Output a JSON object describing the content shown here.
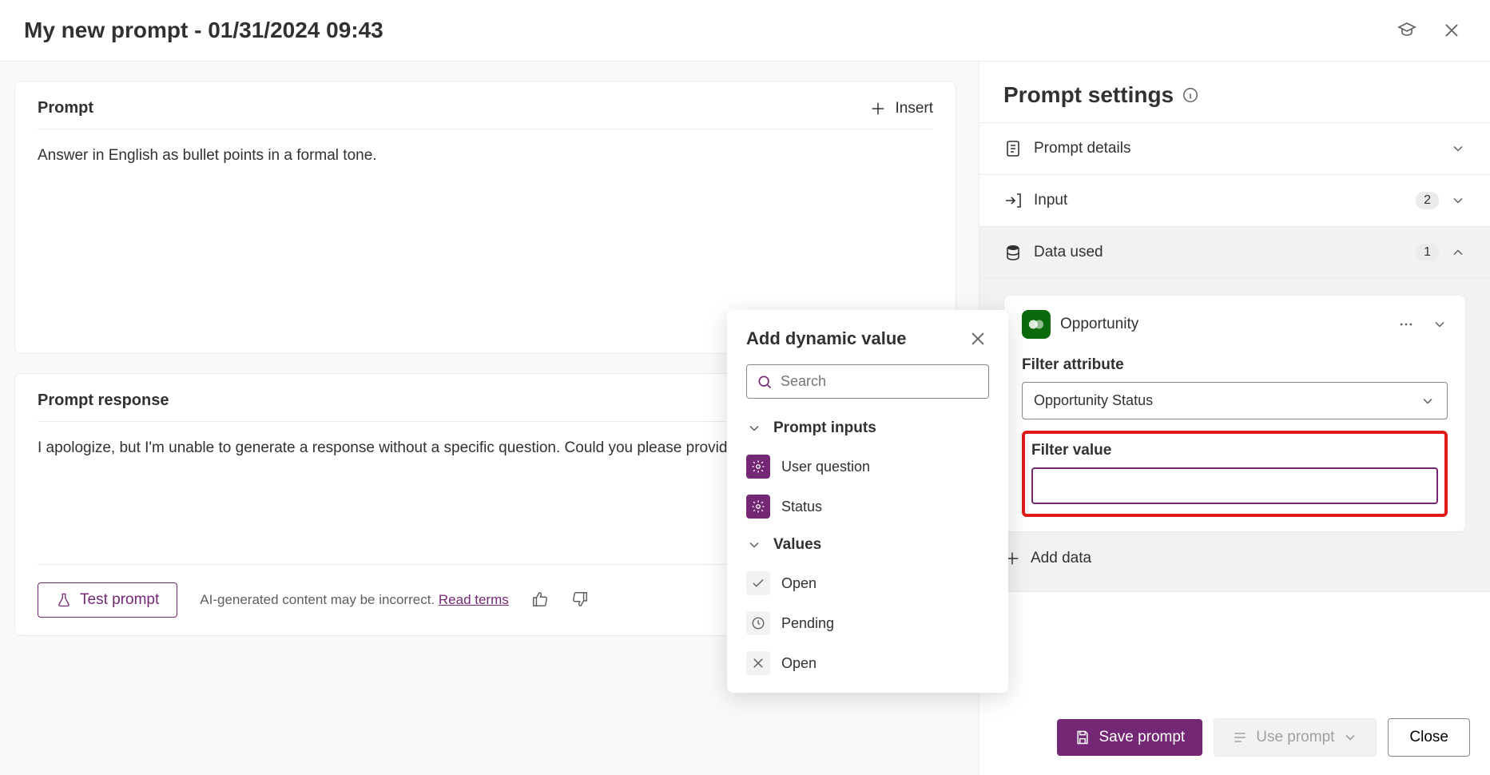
{
  "header": {
    "title": "My new prompt - 01/31/2024 09:43"
  },
  "prompt_panel": {
    "title": "Prompt",
    "insert_label": "Insert",
    "text": "Answer in English as bullet points in a formal tone."
  },
  "response_panel": {
    "title": "Prompt response",
    "text": "I apologize, but I'm unable to generate a response without a specific question. Could you please provide more de",
    "test_label": "Test prompt",
    "disclaimer": "AI-generated content may be incorrect.",
    "terms_label": "Read terms"
  },
  "settings": {
    "title": "Prompt settings",
    "sections": {
      "details": {
        "label": "Prompt details"
      },
      "input": {
        "label": "Input",
        "badge": "2"
      },
      "data": {
        "label": "Data used",
        "badge": "1"
      }
    },
    "data_card": {
      "title": "Opportunity",
      "filter_attr_label": "Filter attribute",
      "filter_attr_value": "Opportunity Status",
      "filter_value_label": "Filter value",
      "filter_value": ""
    },
    "add_data_label": "Add data"
  },
  "popover": {
    "title": "Add dynamic value",
    "search_placeholder": "Search",
    "groups": {
      "inputs": {
        "label": "Prompt inputs",
        "items": [
          "User question",
          "Status"
        ]
      },
      "values": {
        "label": "Values",
        "items": [
          "Open",
          "Pending",
          "Open"
        ]
      }
    }
  },
  "footer": {
    "save": "Save prompt",
    "use": "Use prompt",
    "close": "Close"
  }
}
